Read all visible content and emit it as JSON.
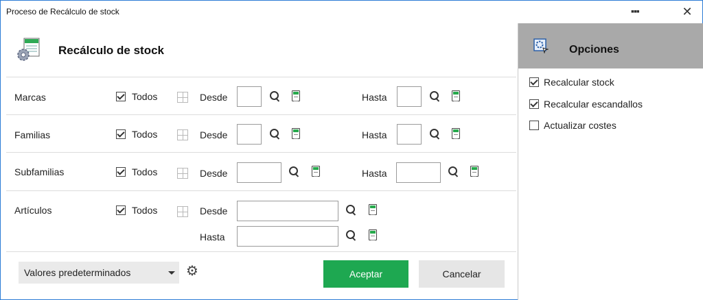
{
  "window": {
    "title": "Proceso de Recálculo de stock",
    "more_label": "▪▪▪",
    "close_label": "✕"
  },
  "header": {
    "title": "Recálculo de stock",
    "icon": "gear-sheet-icon"
  },
  "rows": [
    {
      "label": "Marcas",
      "all_label": "Todos",
      "all_checked": true,
      "from_label": "Desde",
      "from_value": "",
      "to_label": "Hasta",
      "to_value": ""
    },
    {
      "label": "Familias",
      "all_label": "Todos",
      "all_checked": true,
      "from_label": "Desde",
      "from_value": "",
      "to_label": "Hasta",
      "to_value": ""
    },
    {
      "label": "Subfamilias",
      "all_label": "Todos",
      "all_checked": true,
      "from_label": "Desde",
      "from_value": "",
      "to_label": "Hasta",
      "to_value": ""
    },
    {
      "label": "Artículos",
      "all_label": "Todos",
      "all_checked": true,
      "from_label": "Desde",
      "from_value": "",
      "to_label": "Hasta",
      "to_value": ""
    }
  ],
  "footer": {
    "defaults_selected": "Valores predeterminados",
    "accept_label": "Aceptar",
    "cancel_label": "Cancelar"
  },
  "options": {
    "title": "Opciones",
    "items": [
      {
        "label": "Recalcular stock",
        "checked": true
      },
      {
        "label": "Recalcular escandallos",
        "checked": true
      },
      {
        "label": "Actualizar costes",
        "checked": false
      }
    ]
  },
  "colors": {
    "accent": "#1ea851",
    "options_header": "#a9a9a9",
    "window_border": "#2b7bd6"
  }
}
